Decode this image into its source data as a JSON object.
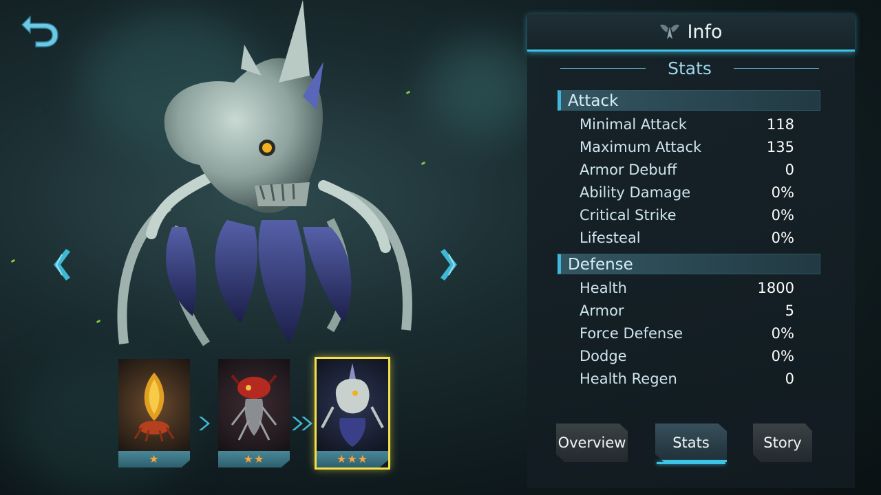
{
  "panel": {
    "title": "Info",
    "subtitle": "Stats",
    "sections": {
      "attack": {
        "label": "Attack",
        "rows": [
          {
            "name": "Minimal Attack",
            "value": "118"
          },
          {
            "name": "Maximum Attack",
            "value": "135"
          },
          {
            "name": "Armor Debuff",
            "value": "0"
          },
          {
            "name": "Ability Damage",
            "value": "0%"
          },
          {
            "name": "Critical Strike",
            "value": "0%"
          },
          {
            "name": "Lifesteal",
            "value": "0%"
          }
        ]
      },
      "defense": {
        "label": "Defense",
        "rows": [
          {
            "name": "Health",
            "value": "1800"
          },
          {
            "name": "Armor",
            "value": "5"
          },
          {
            "name": "Force Defense",
            "value": "0%"
          },
          {
            "name": "Dodge",
            "value": "0%"
          },
          {
            "name": "Health Regen",
            "value": "0"
          }
        ]
      }
    },
    "tabs": {
      "overview": "Overview",
      "stats": "Stats",
      "story": "Story"
    }
  },
  "evolution": [
    {
      "stars": "★",
      "star_count": 1,
      "selected": false
    },
    {
      "stars": "★★",
      "star_count": 2,
      "selected": false
    },
    {
      "stars": "★★★",
      "star_count": 3,
      "selected": true
    }
  ],
  "icons": {
    "back": "back-arrow-icon",
    "prev": "chevron-left-icon",
    "next": "chevron-right-icon",
    "info": "wings-emblem-icon"
  },
  "colors": {
    "accent": "#3fc4e6",
    "selected_border": "#f4e04a",
    "star": "#f4a640"
  }
}
